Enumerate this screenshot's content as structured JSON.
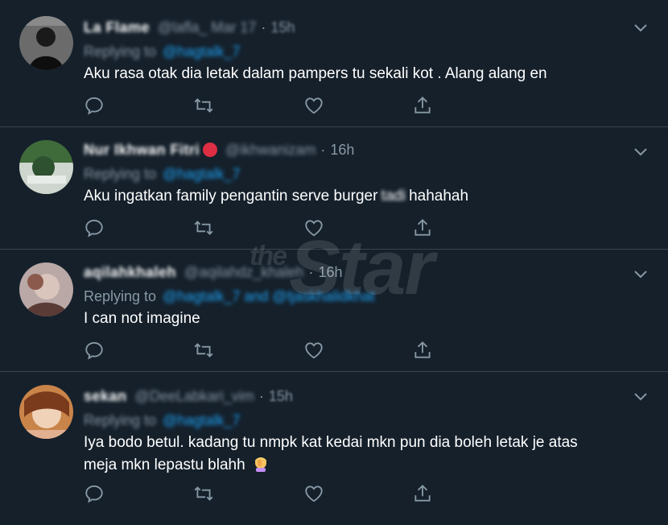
{
  "tweets": [
    {
      "name": "La Flame",
      "handle": "@lafla_ Mar 17",
      "time": "15h",
      "reply_prefix": "Replying to",
      "mention": "@hagtalk_7",
      "text": "Aku rasa otak dia letak dalam pampers tu sekali kot . Alang alang en",
      "blurred_word": ""
    },
    {
      "name": "Nur Ikhwan Fitri",
      "handle": "@ikhwanizam",
      "time": "16h",
      "reply_prefix": "Replying to",
      "mention": "@hagtalk_7",
      "text_before": "Aku ingatkan family pengantin serve burger",
      "blurred_word": "tadi",
      "text_after": "hahahah"
    },
    {
      "name": "aqilahkhaleh",
      "handle": "@aqilahdz_khaleh",
      "time": "16h",
      "reply_prefix": "Replying to",
      "mention": "@hagtalk_7 and @tjaskhalidkhat",
      "text": "I can not imagine"
    },
    {
      "name": "sekan",
      "handle": "@DeeLabkari_vim",
      "time": "15h",
      "reply_prefix": "Replying to",
      "mention": "@hagtalk_7",
      "text_line1": "Iya bodo betul. kadang tu nmpk kat kedai mkn pun dia boleh letak je atas",
      "text_line2": "meja mkn lepastu blahh",
      "emoji": "woman-facepalming-icon"
    }
  ],
  "watermark": {
    "prefix": "the",
    "word": "Star"
  },
  "colors": {
    "background": "#15202b",
    "divider": "#38444d",
    "secondary_text": "#8899a6",
    "link": "#1da1f2"
  },
  "icons": {
    "reply": "reply-icon",
    "retweet": "retweet-icon",
    "like": "heart-icon",
    "share": "share-icon",
    "menu": "chevron-down-icon"
  }
}
